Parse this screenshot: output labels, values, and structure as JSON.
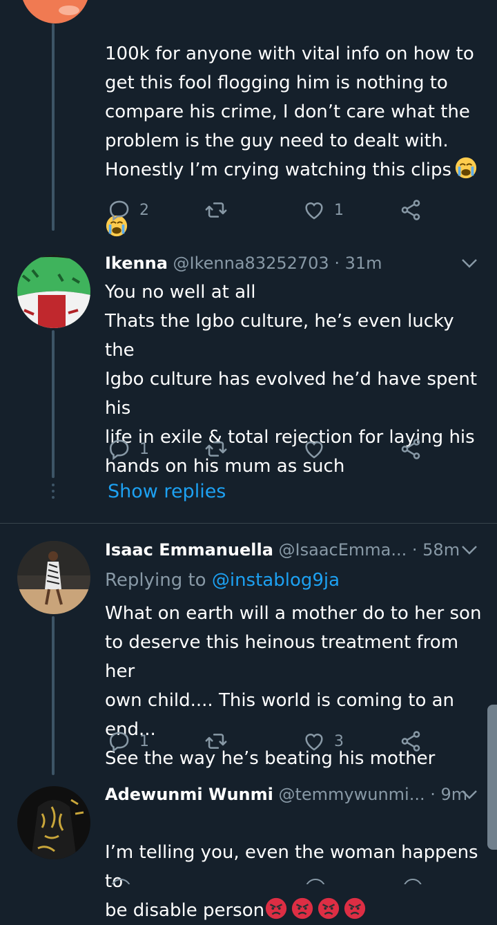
{
  "tweets": [
    {
      "text": "100k for anyone with vital info on how to\nget this fool flogging him is nothing to\ncompare his crime, I don’t care what the\nproblem is the guy need to dealt with.\nHonestly I’m crying watching this clips",
      "emoji": [
        "loudly-crying-face",
        "loudly-crying-face"
      ],
      "replies": "2",
      "retweets": "",
      "likes": "1"
    },
    {
      "name": "Ikenna",
      "handle": "@Ikenna83252703",
      "time": "· 31m",
      "text": "You no well at all\nThats the Igbo culture, he’s even lucky the\nIgbo culture has evolved he’d have spent his\nlife in exile & total rejection for laying his\nhands on his mum as such",
      "replies": "1",
      "retweets": "",
      "likes": ""
    },
    {
      "name": "Isaac Emmanuella",
      "handle": "@IsaacEmma...",
      "time": "· 58m",
      "reply_label": "Replying to",
      "reply_handle": "@instablog9ja",
      "text": "What on earth will a mother do to her son\nto deserve this heinous treatment from her\nown child.... This world is coming to an end...\nSee the way he’s beating his mother",
      "replies": "1",
      "retweets": "",
      "likes": "3"
    },
    {
      "name": "Adewunmi Wunmi",
      "handle": "@temmywunmi...",
      "time": "· 9m",
      "text": "I’m telling you, even the woman happens to\nbe disable person",
      "emoji": [
        "angry-face",
        "angry-face",
        "angry-face",
        "angry-face"
      ]
    }
  ],
  "show_replies": "Show replies",
  "colors": {
    "background": "#15202b",
    "accent": "#1da1f2",
    "muted": "#8899a6"
  }
}
